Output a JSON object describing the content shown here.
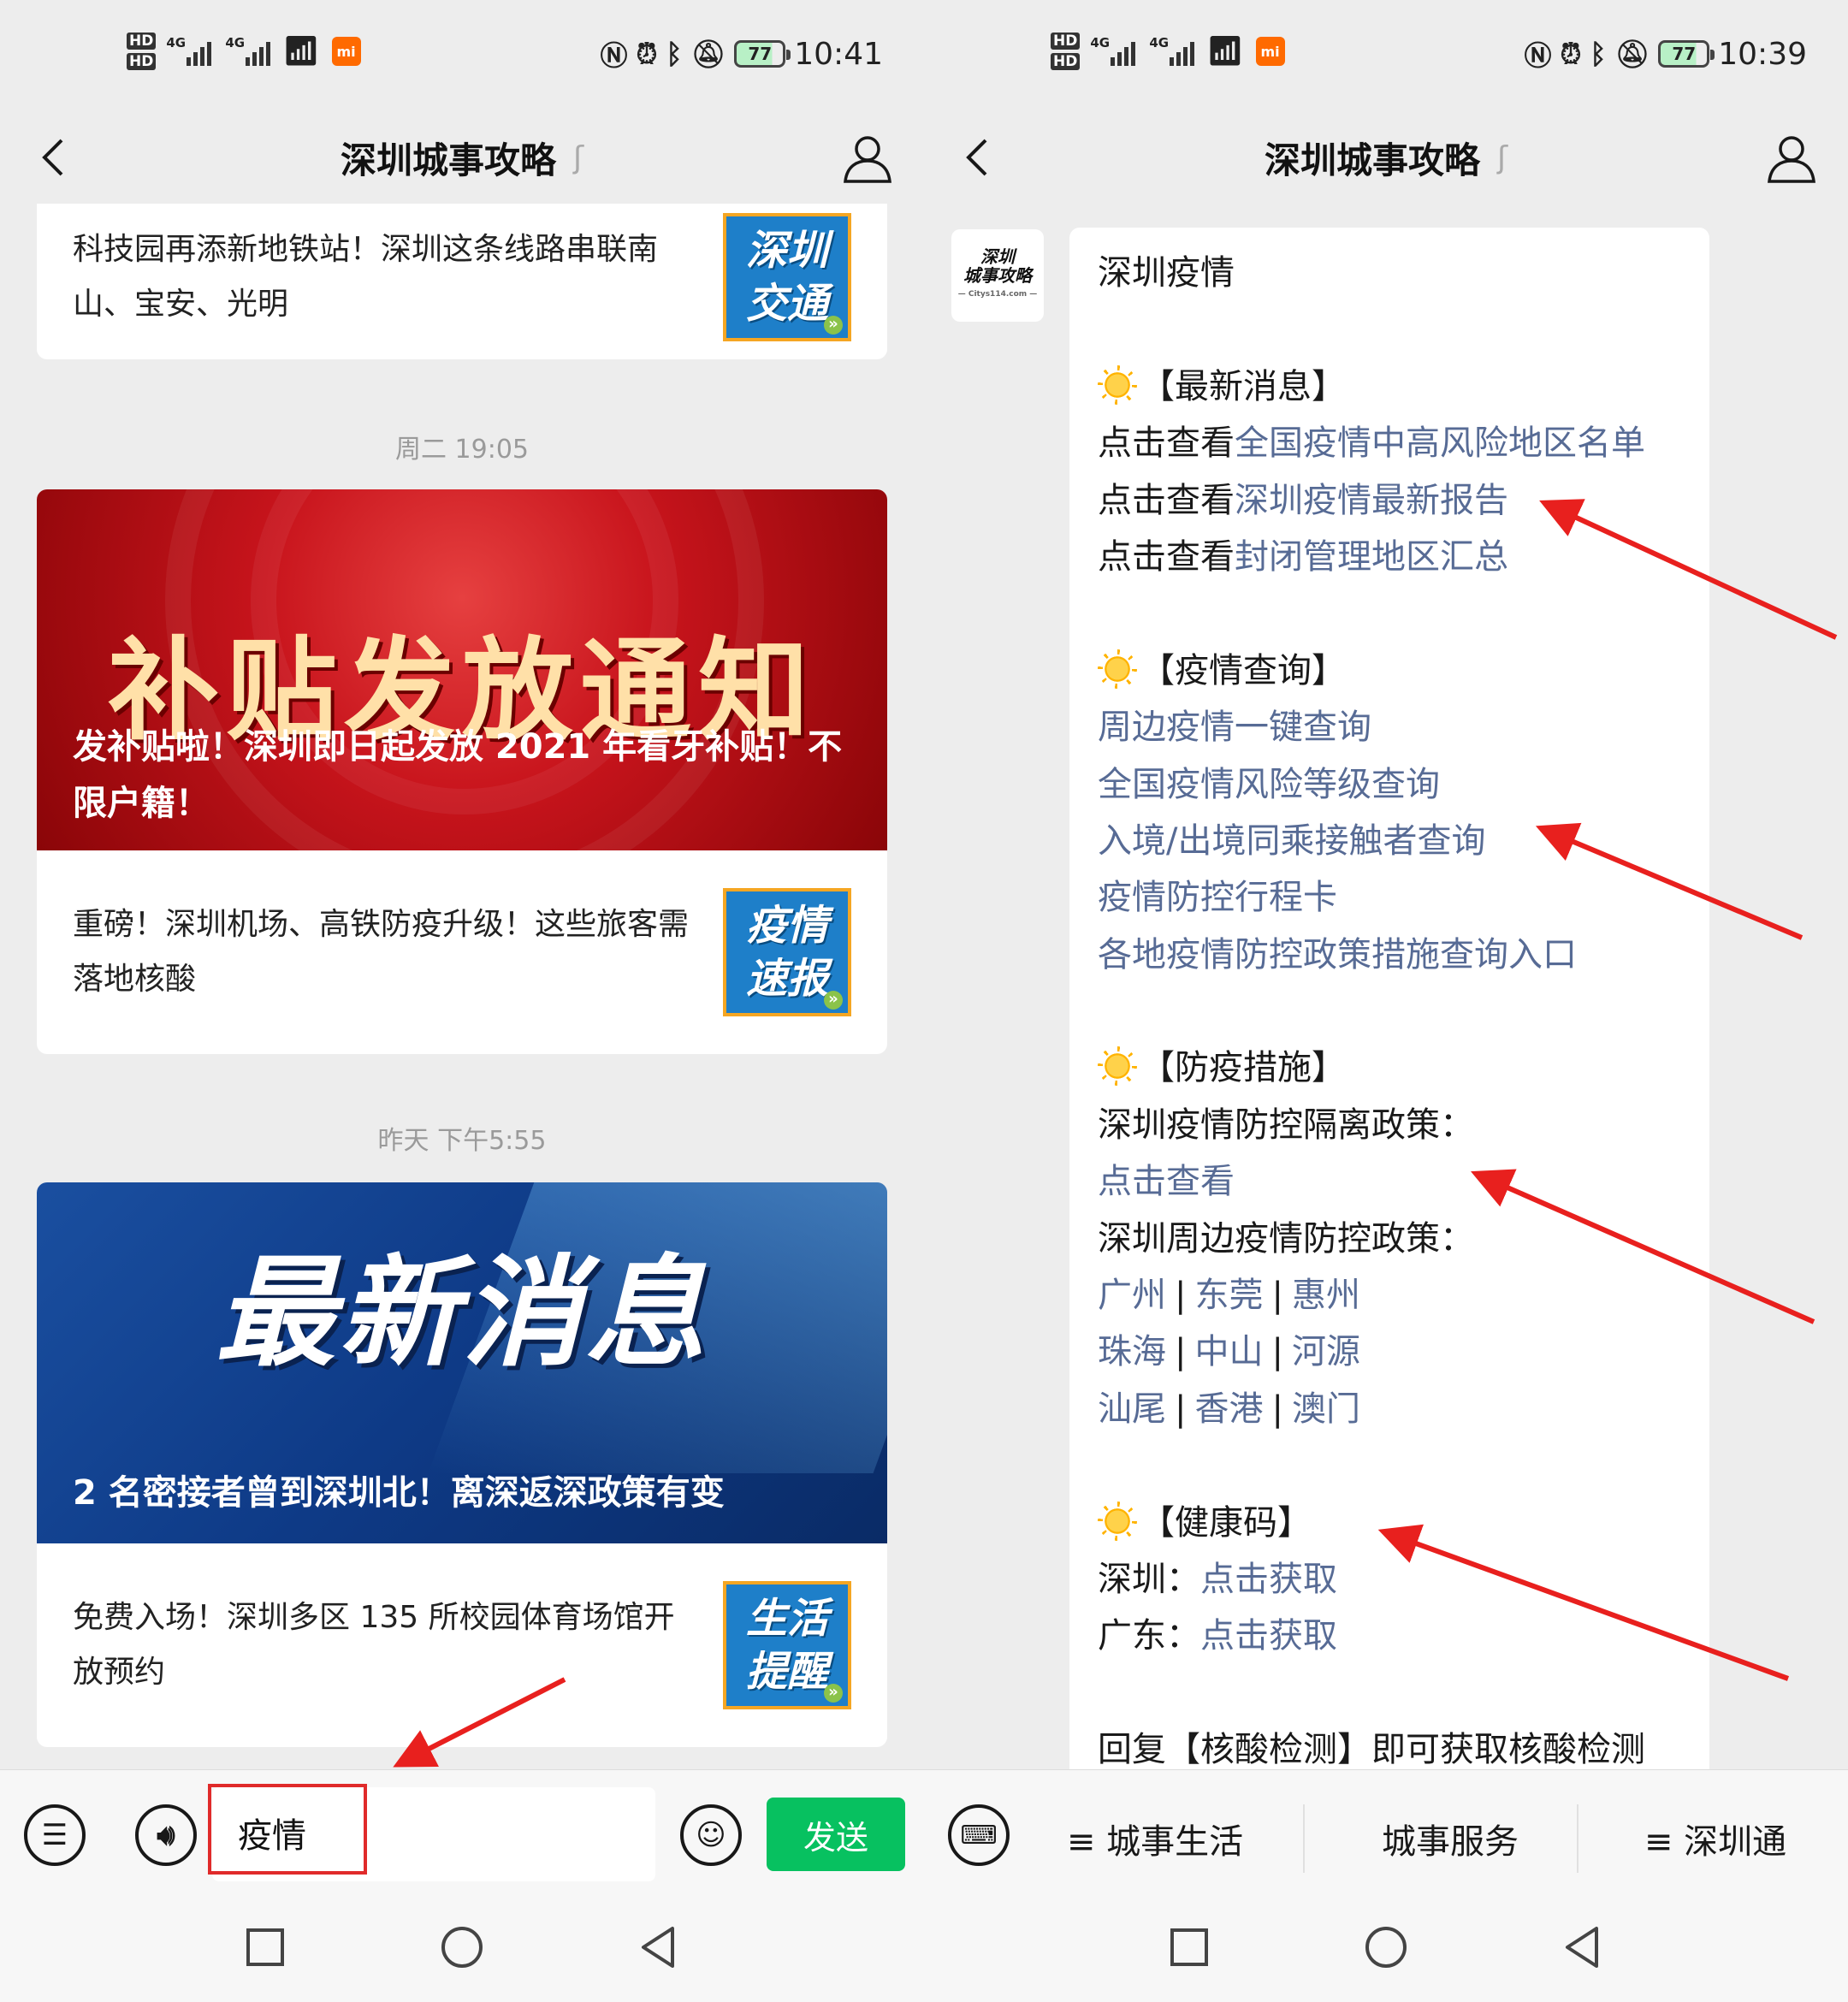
{
  "status_left": {
    "hd1": "HD",
    "hd2": "HD",
    "net1": "4G",
    "net2": "4G",
    "mi": "mi",
    "battery": "77",
    "time": "10:41"
  },
  "status_right": {
    "hd1": "HD",
    "hd2": "HD",
    "net1": "4G",
    "net2": "4G",
    "mi": "mi",
    "battery": "77",
    "time": "10:39"
  },
  "account_title": "深圳城事攻略",
  "left": {
    "card1": {
      "text": "科技园再添新地铁站！深圳这条线路串联南山、宝安、光明",
      "thumb1": "深圳",
      "thumb2": "交通"
    },
    "time1": "周二 19:05",
    "card2": {
      "banner_big": "补贴发放通知",
      "banner_caption": "发补贴啦！深圳即日起发放 2021 年看牙补贴！不限户籍！",
      "item_text": "重磅！深圳机场、高铁防疫升级！这些旅客需落地核酸",
      "thumb1": "疫情",
      "thumb2": "速报"
    },
    "time2": "昨天 下午5:55",
    "card3": {
      "banner_big": "最新消息",
      "banner_caption": "2 名密接者曾到深圳北！离深返深政策有变",
      "item_text": "免费入场！深圳多区 135 所校园体育场馆开放预约",
      "thumb1": "生活",
      "thumb2": "提醒"
    },
    "input": {
      "value": "疫情",
      "send": "发送"
    }
  },
  "right": {
    "avatar": {
      "line1": "深圳",
      "line2": "城事攻略",
      "site": "— Citys114.com —"
    },
    "message": {
      "title": "深圳疫情",
      "s1_head": "【最新消息】",
      "prefix": "点击查看",
      "s1_links": [
        "全国疫情中高风险地区名单",
        "深圳疫情最新报告",
        "封闭管理地区汇总"
      ],
      "s2_head": "【疫情查询】",
      "s2_links": [
        "周边疫情一键查询",
        "全国疫情风险等级查询",
        "入境/出境同乘接触者查询",
        "疫情防控行程卡",
        "各地疫情防控政策措施查询入口"
      ],
      "s3_head": "【防疫措施】",
      "s3_line1": "深圳疫情防控隔离政策：",
      "s3_link1": "点击查看",
      "s3_line2": "深圳周边疫情防控政策：",
      "sep": "|",
      "cities": [
        "广州",
        "东莞",
        "惠州",
        "珠海",
        "中山",
        "河源",
        "汕尾",
        "香港",
        "澳门"
      ],
      "s4_head": "【健康码】",
      "s4_sz": "深圳：",
      "s4_gd": "广东：",
      "s4_link": "点击获取",
      "footer": "回复【核酸检测】即可获取核酸检测"
    },
    "menu": [
      "≡ 城事生活",
      "城事服务",
      "≡ 深圳通"
    ]
  },
  "icons": [
    "back-icon",
    "ear-icon",
    "person-icon",
    "menu-list-icon",
    "voice-icon",
    "emoji-icon",
    "keyboard-icon",
    "nav-square-icon",
    "nav-circle-icon",
    "nav-back-icon",
    "sun-icon",
    "red-arrow"
  ],
  "colors": {
    "link": "#576b95",
    "send": "#07c160",
    "highlight": "#e02a2a",
    "background": "#ededed"
  }
}
